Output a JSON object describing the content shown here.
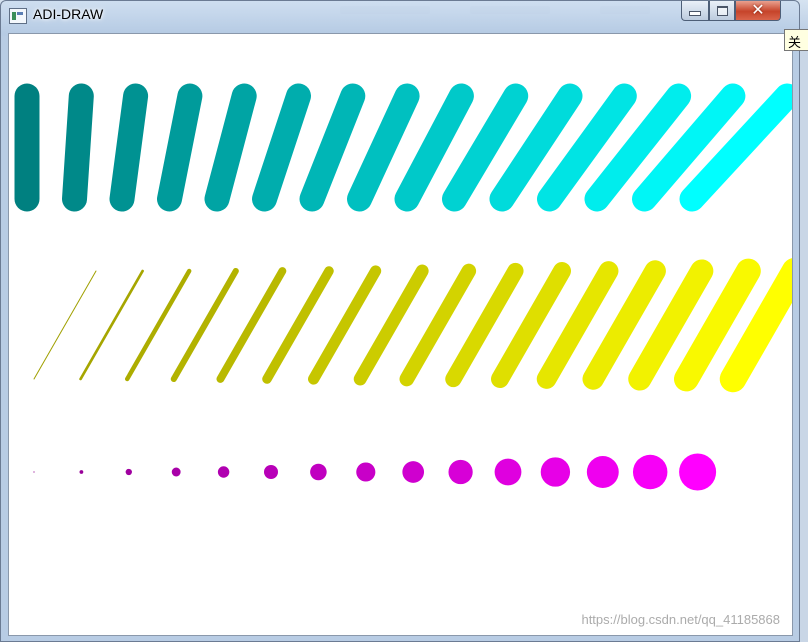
{
  "window": {
    "title": "ADI-DRAW",
    "close_tooltip": "关闭"
  },
  "watermark": "https://blog.csdn.net/qq_41185868",
  "drawing": {
    "row1_capsules": {
      "count": 15,
      "color_start": "#008080",
      "color_end": "#00ffff"
    },
    "row2_lines": {
      "count": 16,
      "color_start": "#a0a000",
      "color_end": "#ffff00"
    },
    "row3_dots": {
      "count": 15,
      "color_start": "#900090",
      "color_end": "#ff00ff"
    }
  }
}
